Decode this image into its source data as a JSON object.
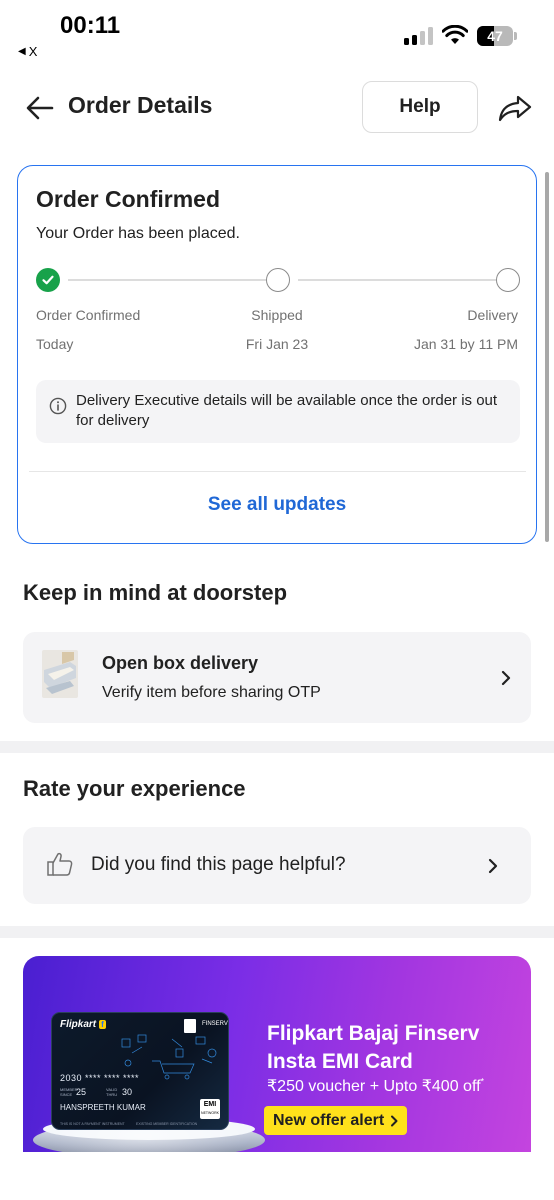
{
  "status_bar": {
    "time": "00:11",
    "back_app": "X",
    "battery": "47",
    "battery_fraction": 0.47
  },
  "header": {
    "title": "Order Details",
    "help_label": "Help"
  },
  "order_card": {
    "title": "Order Confirmed",
    "subtitle": "Your Order has been placed.",
    "steps": [
      {
        "label": "Order Confirmed",
        "date": "Today",
        "done": true
      },
      {
        "label": "Shipped",
        "date": "Fri Jan 23",
        "done": false
      },
      {
        "label": "Delivery",
        "date": "Jan 31 by 11 PM",
        "done": false
      }
    ],
    "info_text": "Delivery Executive details will be available once the order is out for delivery",
    "see_updates": "See all updates"
  },
  "doorstep": {
    "section_title": "Keep in mind at doorstep",
    "title": "Open box delivery",
    "subtitle": "Verify item before sharing OTP"
  },
  "rating": {
    "section_title": "Rate your experience",
    "question": "Did you find this page helpful?"
  },
  "banner": {
    "title_line1": "Flipkart Bajaj Finserv",
    "title_line2": "Insta EMI Card",
    "offer": "₹250 voucher + Upto ₹400 off",
    "offer_mark": "*",
    "cta": "New offer alert",
    "card": {
      "brand": "Flipkart",
      "brand_badge": "f",
      "partner": "FINSERV",
      "number": "2030 **** **** ****",
      "member_since_label": "MEMBER SINCE",
      "member_since": "25",
      "valid_thru_label": "VALID THRU",
      "valid_thru": "30",
      "holder": "HANSPREETH KUMAR",
      "footer": "THIS IS NOT A PAYMENT INSTRUMENT",
      "emi": "EMI",
      "emi_sub": "NETWORK",
      "id_text": "EXISTING MEMBER IDENTIFICATION"
    }
  },
  "colors": {
    "accent_blue": "#2874f0",
    "link_blue": "#2068d6",
    "success_green": "#18a24a",
    "cta_yellow": "#ffe11b"
  }
}
